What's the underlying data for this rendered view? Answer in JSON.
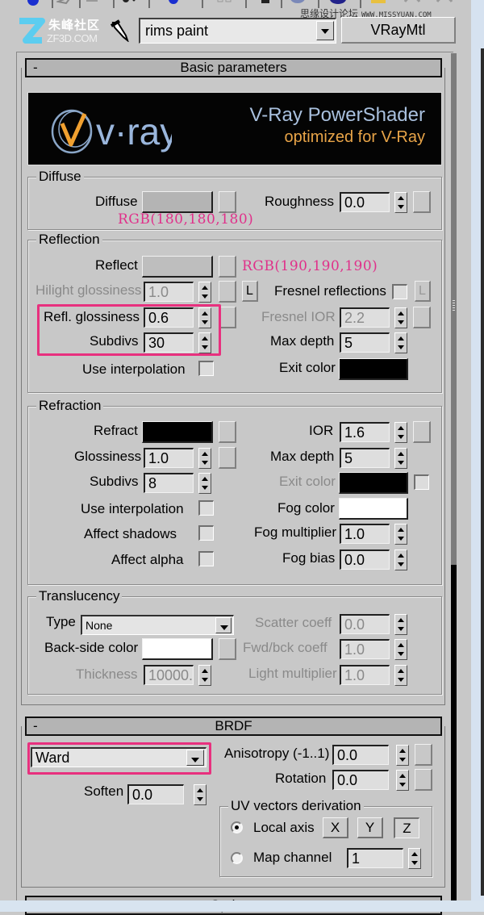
{
  "toolbar": {
    "icons": [
      "sphere-icon",
      "pick-icon",
      "put-icon",
      "assign-icon",
      "reset-icon",
      "copy-icon",
      "unique-icon",
      "put-library-icon",
      "effects-channel-icon",
      "show-map-icon",
      "show-end-icon",
      "go-parent-icon",
      "go-forward-icon"
    ]
  },
  "watermarks": {
    "left_cn": "朱峰社区",
    "left_en": "ZF3D.COM",
    "right_cn": "思缘设计论坛",
    "right_url": "WWW.MISSYUAN.COM"
  },
  "header": {
    "material_name": "rims paint",
    "material_type": "VRayMtl"
  },
  "basic_parameters": {
    "title": "Basic parameters",
    "collapse": "-",
    "banner": {
      "logo_text": "v·ray",
      "title": "V-Ray PowerShader",
      "subtitle": "optimized for V-Ray"
    },
    "diffuse": {
      "group": "Diffuse",
      "diffuse_label": "Diffuse",
      "diffuse_color": "#b4b4b4",
      "roughness_label": "Roughness",
      "roughness": "0.0",
      "annotation": "RGB(180,180,180)"
    },
    "reflection": {
      "group": "Reflection",
      "reflect_label": "Reflect",
      "reflect_color": "#bebebe",
      "annotation": "RGB(190,190,190)",
      "hilight_label": "Hilight glossiness",
      "hilight": "1.0",
      "lock_label": "L",
      "fresnel_label": "Fresnel reflections",
      "fresnel_checked": false,
      "fresnel_lock": "L",
      "refl_gloss_label": "Refl. glossiness",
      "refl_gloss": "0.6",
      "fresnel_ior_label": "Fresnel IOR",
      "fresnel_ior": "2.2",
      "subdivs_label": "Subdivs",
      "subdivs": "30",
      "max_depth_label": "Max depth",
      "max_depth": "5",
      "use_interp_label": "Use interpolation",
      "use_interp": false,
      "exit_color_label": "Exit color",
      "exit_color": "#000000"
    },
    "refraction": {
      "group": "Refraction",
      "refract_label": "Refract",
      "refract_color": "#000000",
      "ior_label": "IOR",
      "ior": "1.6",
      "gloss_label": "Glossiness",
      "gloss": "1.0",
      "max_depth_label": "Max depth",
      "max_depth": "5",
      "subdivs_label": "Subdivs",
      "subdivs": "8",
      "exit_color_label": "Exit color",
      "exit_color": "#000000",
      "use_interp_label": "Use interpolation",
      "fog_color_label": "Fog color",
      "fog_color": "#ffffff",
      "affect_shadows_label": "Affect shadows",
      "fog_mult_label": "Fog multiplier",
      "fog_mult": "1.0",
      "affect_alpha_label": "Affect alpha",
      "fog_bias_label": "Fog bias",
      "fog_bias": "0.0"
    },
    "translucency": {
      "group": "Translucency",
      "type_label": "Type",
      "type": "None",
      "scatter_label": "Scatter coeff",
      "scatter": "0.0",
      "backside_label": "Back-side color",
      "backside_color": "#ffffff",
      "fwdbck_label": "Fwd/bck coeff",
      "fwdbck": "1.0",
      "thickness_label": "Thickness",
      "thickness": "10000.",
      "light_mult_label": "Light multiplier",
      "light_mult": "1.0"
    }
  },
  "brdf": {
    "title": "BRDF",
    "collapse": "-",
    "type": "Ward",
    "anisotropy_label": "Anisotropy (-1..1)",
    "anisotropy": "0.0",
    "rotation_label": "Rotation",
    "rotation": "0.0",
    "soften_label": "Soften",
    "soften": "0.0",
    "uv": {
      "group": "UV vectors derivation",
      "local_axis_label": "Local axis",
      "local_axis_selected": true,
      "axes": [
        "X",
        "Y",
        "Z"
      ],
      "active_axis": "Z",
      "map_channel_label": "Map channel",
      "map_channel": "1"
    }
  },
  "next_rollout": {
    "title": "Options"
  },
  "colors": {
    "highlight": "#e8307e",
    "annotation": "#e0308a",
    "panel_bg": "#c8c8c8"
  }
}
